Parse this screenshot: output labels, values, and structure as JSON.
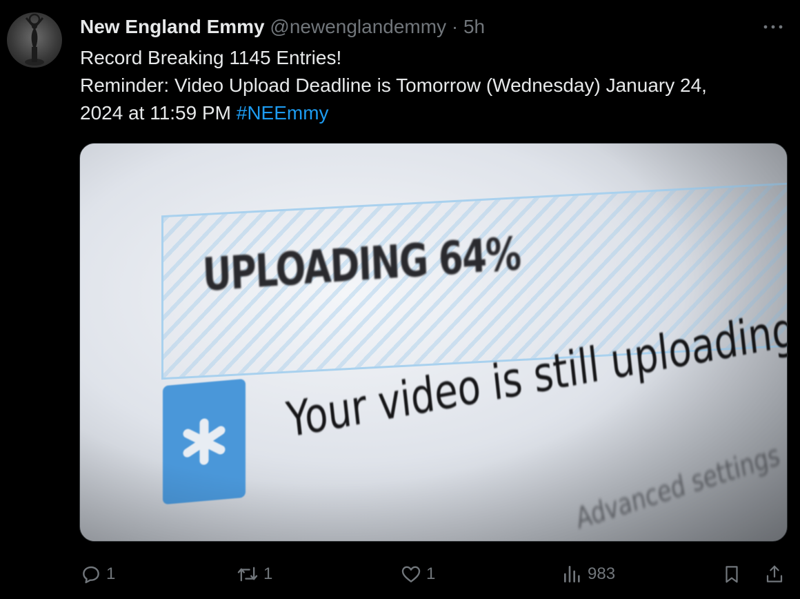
{
  "author": {
    "display_name": "New England Emmy",
    "handle": "@newenglandemmy",
    "separator": "·",
    "time": "5h",
    "avatar_icon": "emmy-statuette-icon"
  },
  "more_icon": "more-horizontal-icon",
  "tweet": {
    "line1": "Record Breaking 1145 Entries!",
    "line2": "Reminder: Video Upload Deadline is Tomorrow (Wednesday) January 24,",
    "line3_text": "2024 at 11:59 PM ",
    "hashtag": "#NEEmmy"
  },
  "media": {
    "uploading_text": "UPLOADING 64%",
    "still_uploading_text": "Your video is still uploading. Pl",
    "advanced_text": "Advanced settings",
    "upload_progress_percent": 64
  },
  "actions": {
    "reply_count": "1",
    "retweet_count": "1",
    "like_count": "1",
    "views_count": "983"
  },
  "colors": {
    "background": "#000000",
    "text_primary": "#e7e9ea",
    "text_secondary": "#71767b",
    "link": "#1d9bf0",
    "media_star_box": "#4a97d9"
  }
}
